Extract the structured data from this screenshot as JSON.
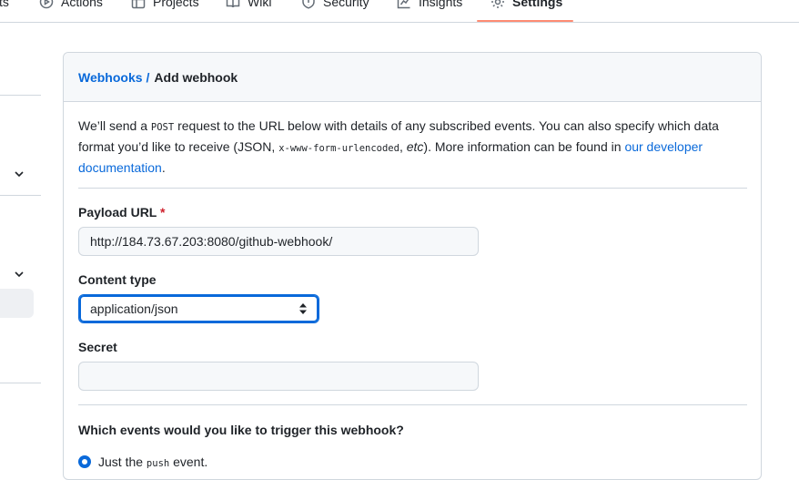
{
  "repo_tabs": [
    {
      "label": "Actions",
      "icon": "play-icon"
    },
    {
      "label": "Projects",
      "icon": "table-icon"
    },
    {
      "label": "Wiki",
      "icon": "book-icon"
    },
    {
      "label": "Security",
      "icon": "shield-icon"
    },
    {
      "label": "Insights",
      "icon": "graph-icon"
    },
    {
      "label": "Settings",
      "icon": "gear-icon",
      "selected": true
    }
  ],
  "partial_tab": "ts",
  "breadcrumb": {
    "parent": "Webhooks",
    "separator": "/",
    "current": "Add webhook"
  },
  "intro": {
    "part1": "We’ll send a ",
    "post_code": "POST",
    "part2": " request to the URL below with details of any subscribed events. You can also specify which data format you’d like to receive (JSON, ",
    "form_code": "x-www-form-urlencoded",
    "part3": ", ",
    "etc": "etc",
    "part4": "). More information can be found in ",
    "link_text": "our developer documentation",
    "part5": "."
  },
  "payload_url": {
    "label": "Payload URL",
    "required_marker": "*",
    "value": "http://184.73.67.203:8080/github-webhook/"
  },
  "content_type": {
    "label": "Content type",
    "selected": "application/json"
  },
  "secret": {
    "label": "Secret",
    "value": ""
  },
  "events": {
    "question": "Which events would you like to trigger this webhook?",
    "option1_prefix": "Just the ",
    "option1_code": "push",
    "option1_suffix": " event."
  },
  "colors": {
    "accent": "#0969da",
    "tab_underline": "#fd8c73",
    "required": "#cf222e"
  }
}
